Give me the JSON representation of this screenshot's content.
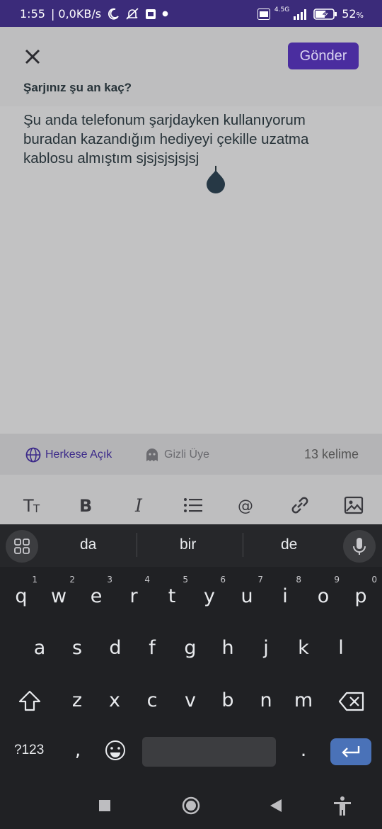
{
  "status_bar": {
    "time": "1:55",
    "speed": "| 0,0KB/s",
    "network": "4.5G",
    "battery": "52",
    "battery_unit": "%"
  },
  "header": {
    "send_label": "Gönder",
    "question": "Şarjınız şu an kaç?"
  },
  "editor": {
    "text": "Şu anda telefonum şarjdayken kullanıyorum\nburadan kazandığım hediyeyi çekille uzatma\nkablosu almıştım sjsjsjsjsjsj"
  },
  "meta": {
    "public_label": "Herkese Açık",
    "hidden_label": "Gizli Üye",
    "word_count": "13 kelime"
  },
  "keyboard": {
    "suggestions": [
      "da",
      "bir",
      "de"
    ],
    "row1": [
      "q",
      "w",
      "e",
      "r",
      "t",
      "y",
      "u",
      "i",
      "o",
      "p"
    ],
    "row1_nums": [
      "1",
      "2",
      "3",
      "4",
      "5",
      "6",
      "7",
      "8",
      "9",
      "0"
    ],
    "row2": [
      "a",
      "s",
      "d",
      "f",
      "g",
      "h",
      "j",
      "k",
      "l"
    ],
    "row3": [
      "z",
      "x",
      "c",
      "v",
      "b",
      "n",
      "m"
    ],
    "symbols_label": "?123",
    "comma": ",",
    "period": "."
  },
  "colors": {
    "accent": "#4a2d9f",
    "status_bar": "#3b2b7a",
    "keyboard_bg": "#202124",
    "enter_key": "#4a72b8"
  }
}
